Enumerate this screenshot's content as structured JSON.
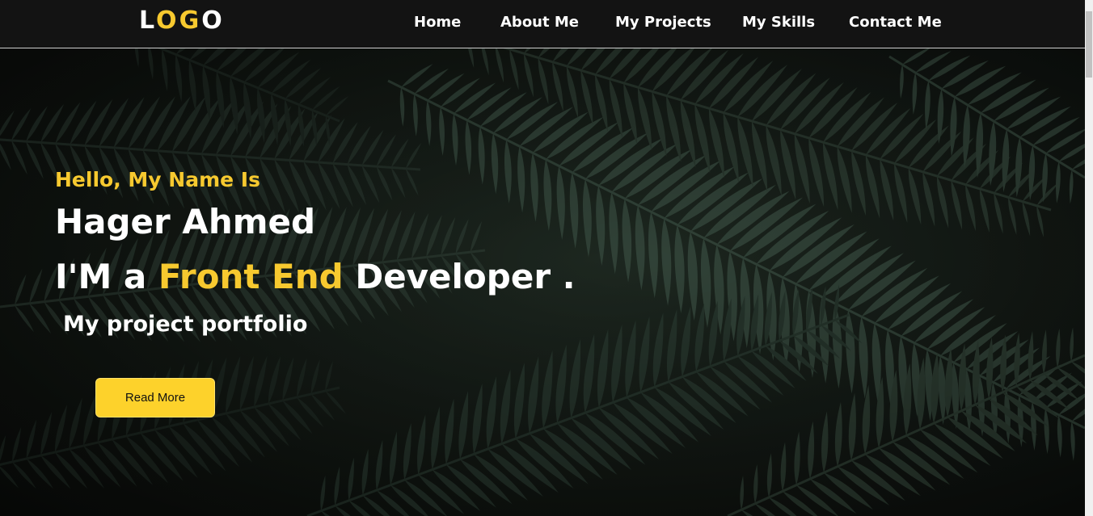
{
  "logo": {
    "parts": [
      "L",
      "O",
      "G",
      "O"
    ]
  },
  "nav": {
    "items": [
      "Home",
      "About Me",
      "My Projects",
      "My Skills",
      "Contact Me"
    ]
  },
  "hero": {
    "greeting": "Hello, My Name Is",
    "name": "Hager Ahmed",
    "role_prefix": "I'M a",
    "role_highlight": "Front End",
    "role_suffix": "Developer .",
    "subtitle": "My project portfolio",
    "button_label": "Read More",
    "background_image": "fern-leaves-icon"
  },
  "colors": {
    "accent": "#f7c92f",
    "nav_bg": "#131313",
    "button_bg": "#fdd22b",
    "text": "#ffffff"
  }
}
